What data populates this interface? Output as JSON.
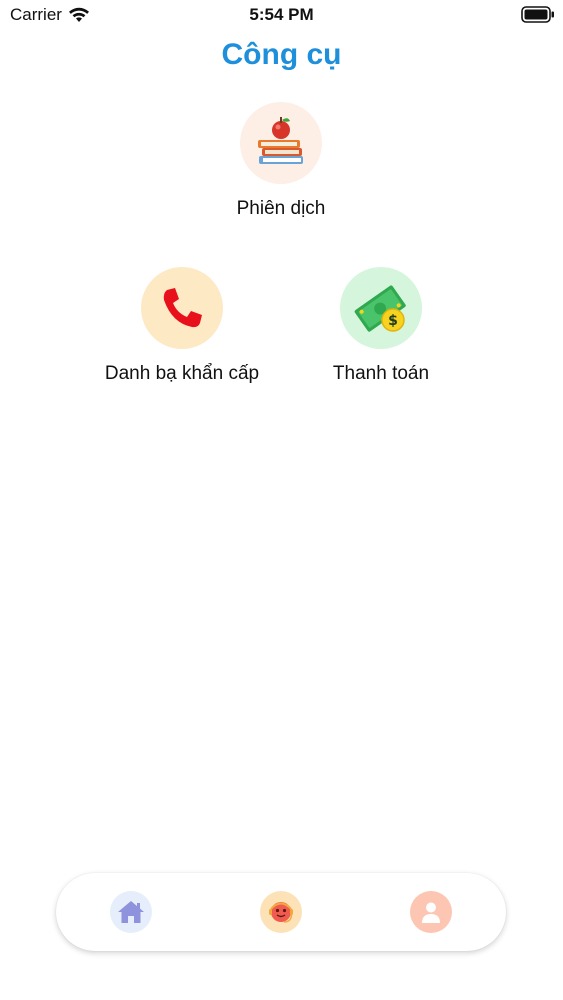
{
  "status_bar": {
    "carrier": "Carrier",
    "time": "5:54 PM",
    "icons": [
      "wifi-icon",
      "battery-icon"
    ]
  },
  "header": {
    "title": "Công cụ"
  },
  "tools": [
    {
      "label": "Phiên dịch",
      "icon": "books-apple-icon",
      "bg": "#fdeee6"
    },
    {
      "label": "Danh bạ khẩn cấp",
      "icon": "phone-icon",
      "bg": "#fde9c4"
    },
    {
      "label": "Thanh toán",
      "icon": "money-icon",
      "bg": "#d5f5dd"
    }
  ],
  "bottom_nav": {
    "items": [
      {
        "icon": "home-icon",
        "bg": "#e6eefb"
      },
      {
        "icon": "chatbot-icon",
        "bg": "#fde2b8"
      },
      {
        "icon": "profile-icon",
        "bg": "#fcc6b3"
      }
    ]
  },
  "colors": {
    "title": "#1e8fdb",
    "home": "#8f93dd",
    "phone": "#e8101b",
    "money_green": "#2fa84f",
    "coin": "#f7d31f"
  }
}
